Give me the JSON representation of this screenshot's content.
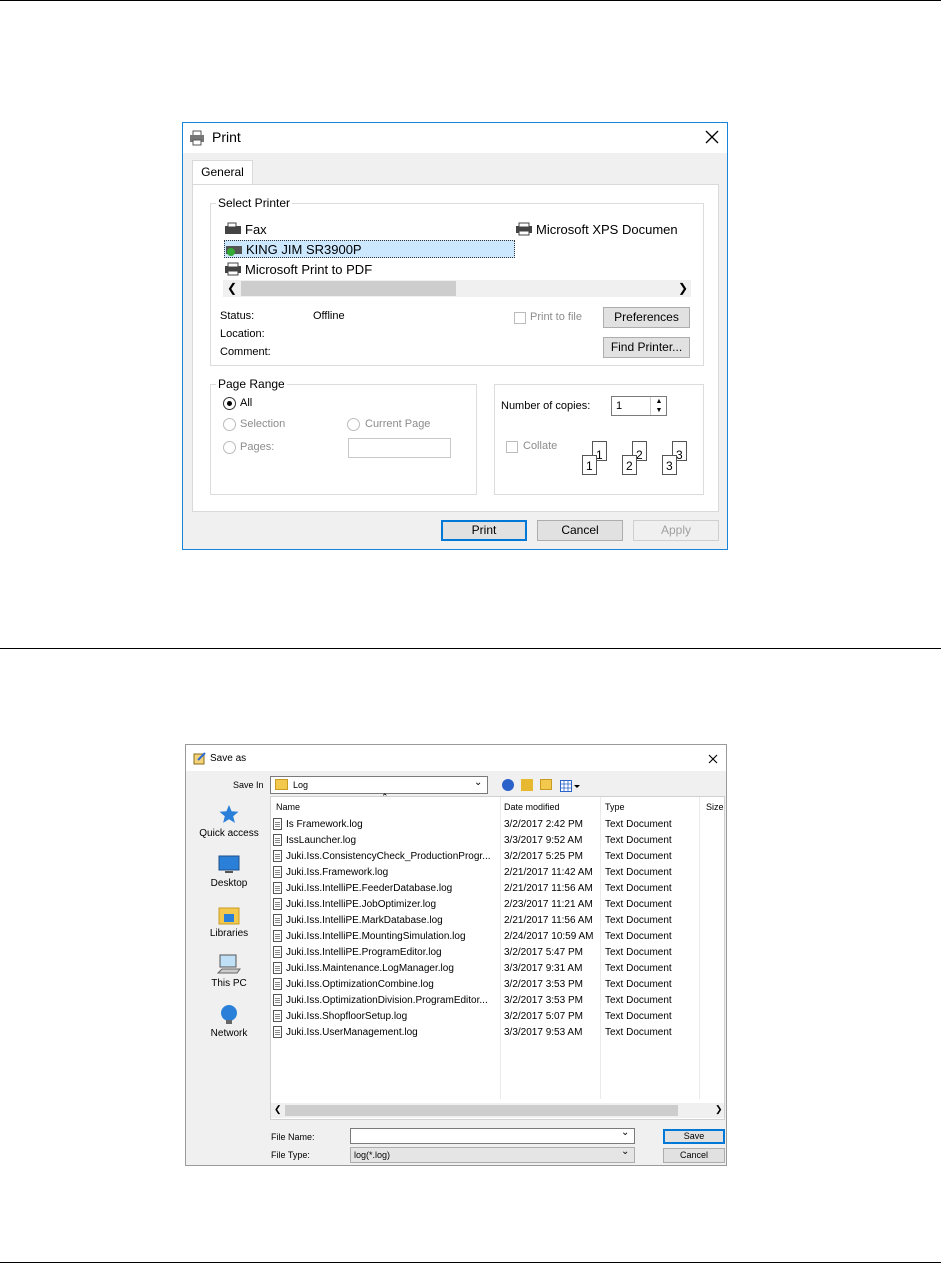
{
  "print": {
    "title": "Print",
    "tab": "General",
    "select_printer_label": "Select Printer",
    "printers": [
      "Fax",
      "KING JIM SR3900P",
      "Microsoft Print to PDF",
      "Microsoft XPS Documen"
    ],
    "status_label": "Status:",
    "status_value": "Offline",
    "location_label": "Location:",
    "comment_label": "Comment:",
    "print_to_file": "Print to file",
    "preferences": "Preferences",
    "find_printer": "Find Printer...",
    "page_range_label": "Page Range",
    "all": "All",
    "selection": "Selection",
    "current_page": "Current Page",
    "pages": "Pages:",
    "copies_label": "Number of copies:",
    "copies_value": "1",
    "collate": "Collate",
    "print_btn": "Print",
    "cancel_btn": "Cancel",
    "apply_btn": "Apply",
    "collate_numbers": [
      "1",
      "1",
      "2",
      "2",
      "3",
      "3"
    ]
  },
  "saveas": {
    "title": "Save as",
    "save_in_label": "Save In",
    "save_in_value": "Log",
    "columns": [
      "Name",
      "Date modified",
      "Type",
      "Size"
    ],
    "nav": [
      "Quick access",
      "Desktop",
      "Libraries",
      "This PC",
      "Network"
    ],
    "files": [
      {
        "name": "Is Framework.log",
        "date": "3/2/2017 2:42 PM",
        "type": "Text Document"
      },
      {
        "name": "IssLauncher.log",
        "date": "3/3/2017 9:52 AM",
        "type": "Text Document"
      },
      {
        "name": "Juki.Iss.ConsistencyCheck_ProductionProgr...",
        "date": "3/2/2017 5:25 PM",
        "type": "Text Document"
      },
      {
        "name": "Juki.Iss.Framework.log",
        "date": "2/21/2017 11:42 AM",
        "type": "Text Document"
      },
      {
        "name": "Juki.Iss.IntelliPE.FeederDatabase.log",
        "date": "2/21/2017 11:56 AM",
        "type": "Text Document"
      },
      {
        "name": "Juki.Iss.IntelliPE.JobOptimizer.log",
        "date": "2/23/2017 11:21 AM",
        "type": "Text Document"
      },
      {
        "name": "Juki.Iss.IntelliPE.MarkDatabase.log",
        "date": "2/21/2017 11:56 AM",
        "type": "Text Document"
      },
      {
        "name": "Juki.Iss.IntelliPE.MountingSimulation.log",
        "date": "2/24/2017 10:59 AM",
        "type": "Text Document"
      },
      {
        "name": "Juki.Iss.IntelliPE.ProgramEditor.log",
        "date": "3/2/2017 5:47 PM",
        "type": "Text Document"
      },
      {
        "name": "Juki.Iss.Maintenance.LogManager.log",
        "date": "3/3/2017 9:31 AM",
        "type": "Text Document"
      },
      {
        "name": "Juki.Iss.OptimizationCombine.log",
        "date": "3/2/2017 3:53 PM",
        "type": "Text Document"
      },
      {
        "name": "Juki.Iss.OptimizationDivision.ProgramEditor...",
        "date": "3/2/2017 3:53 PM",
        "type": "Text Document"
      },
      {
        "name": "Juki.Iss.ShopfloorSetup.log",
        "date": "3/2/2017 5:07 PM",
        "type": "Text Document"
      },
      {
        "name": "Juki.Iss.UserManagement.log",
        "date": "3/3/2017 9:53 AM",
        "type": "Text Document"
      }
    ],
    "file_name_label": "File Name:",
    "file_name_value": "",
    "file_type_label": "File Type:",
    "file_type_value": "log(*.log)",
    "save_btn": "Save",
    "cancel_btn": "Cancel"
  }
}
